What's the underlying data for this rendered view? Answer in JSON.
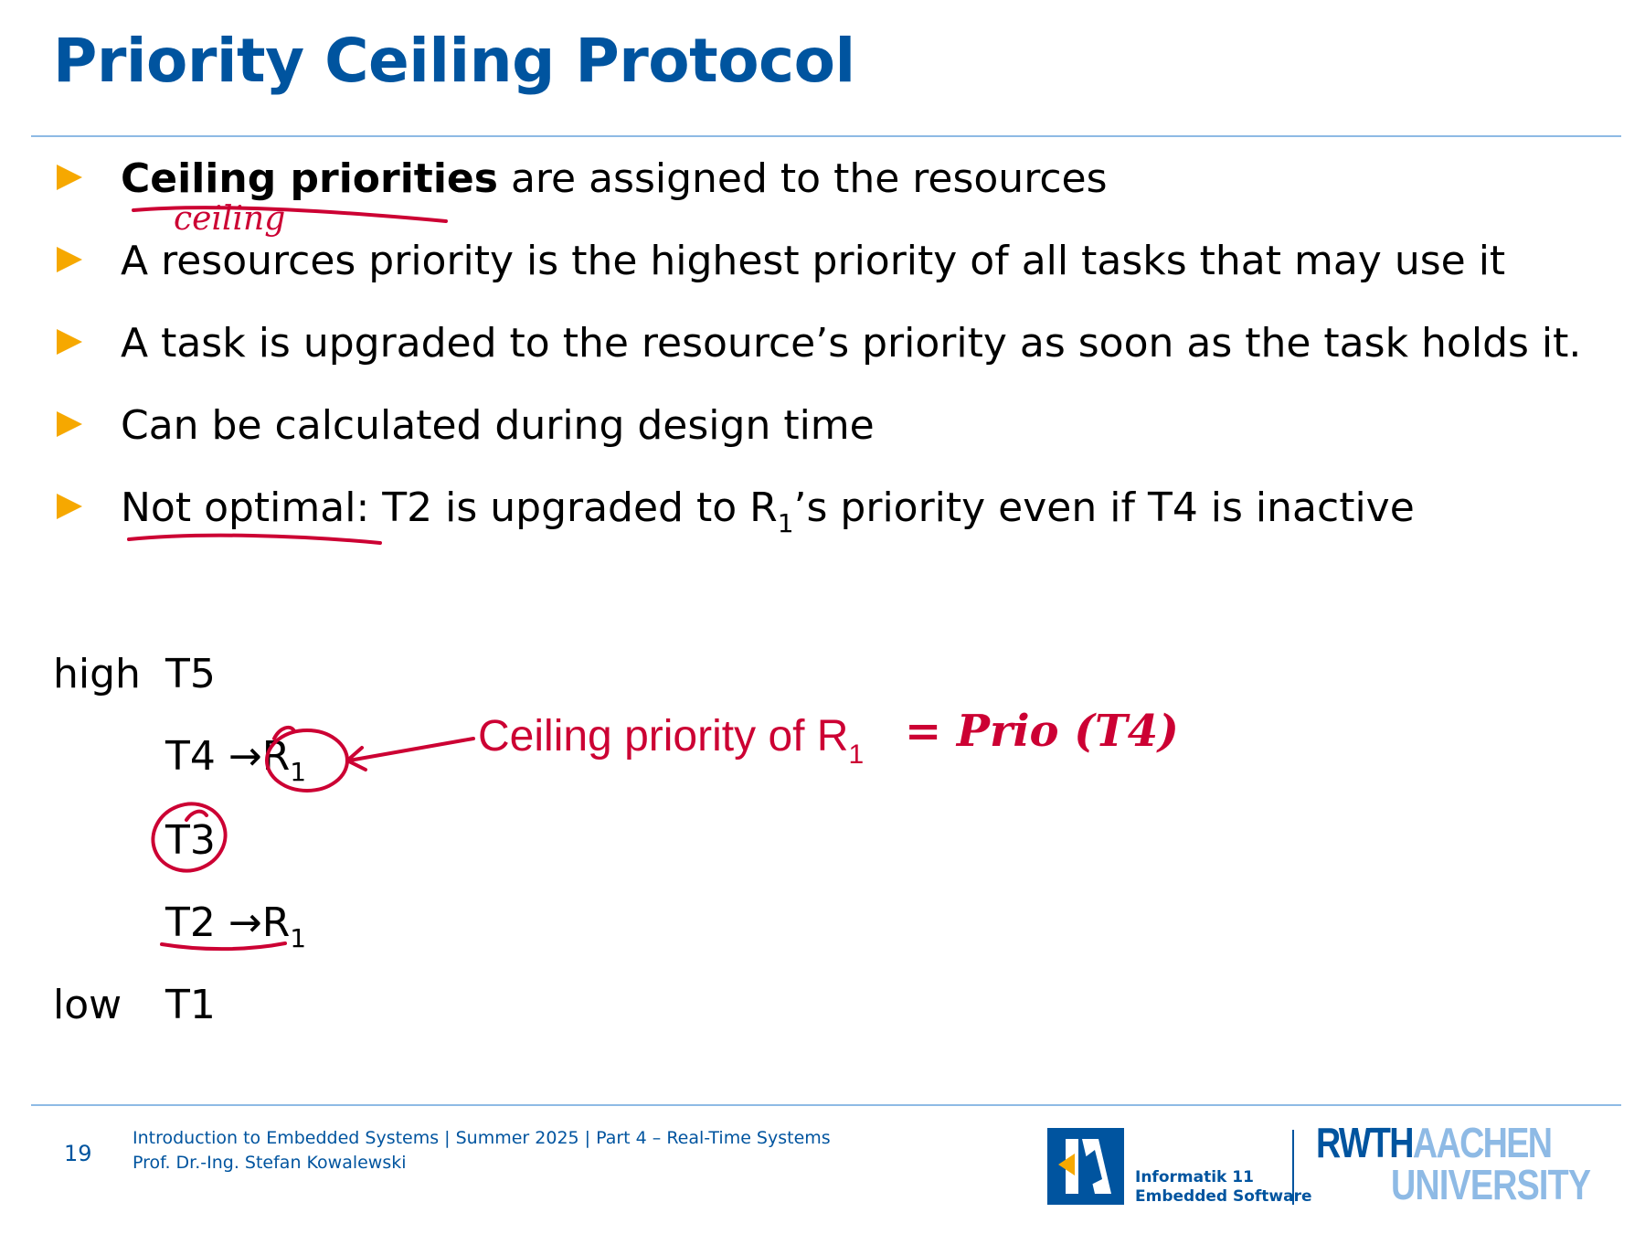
{
  "slide": {
    "title": "Priority Ceiling Protocol",
    "bullets": [
      {
        "bold": "Ceiling priorities",
        "text": " are assigned to the resources"
      },
      {
        "text": "A resources priority is the highest priority of all tasks that may use it"
      },
      {
        "text": "A task is upgraded to the resource’s priority as soon as the task holds it."
      },
      {
        "text": "Can be calculated during design time"
      },
      {
        "pre": "Not optimal: T2 is upgraded to R",
        "sub": "1",
        "post": "’s priority even if T4 is inactive"
      }
    ],
    "levels": {
      "high": "high",
      "low": "low"
    },
    "tasks": {
      "t5": "T5",
      "t4": "T4 →R",
      "t4_sub": "1",
      "t3": "T3",
      "t2": "T2 →R",
      "t2_sub": "1",
      "t1": "T1"
    },
    "callout": {
      "text": "Ceiling priority of R",
      "sub": "1"
    },
    "annotations": {
      "ceiling_note": "ceiling",
      "prio_note": "= Prio (T4)"
    }
  },
  "footer": {
    "page_number": "19",
    "line1": "Introduction to Embedded Systems | Summer 2025 | Part 4 – Real-Time Systems",
    "line2": "Prof. Dr.-Ing. Stefan Kowalewski",
    "dept1": "Informatik 11",
    "dept2": "Embedded Software",
    "uni_a": "RWTH",
    "uni_b": "AACHEN",
    "uni_c": "UNIVERSITY"
  },
  "colors": {
    "title": "#00549f",
    "bullet": "#f6a800",
    "ink": "#cc0033",
    "rule": "#8ebae5"
  }
}
